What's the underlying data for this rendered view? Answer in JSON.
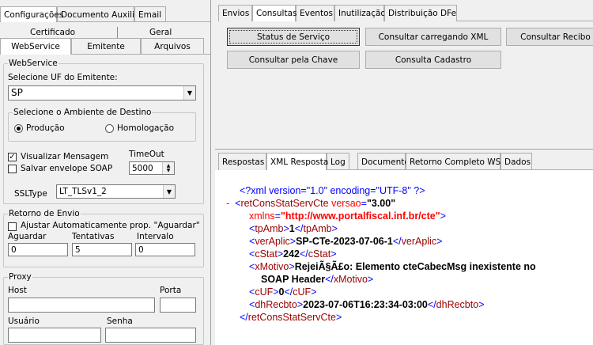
{
  "left_tabs": [
    "Configurações",
    "Documento Auxiliar",
    "Email"
  ],
  "config_tabs_row1": [
    "Certificado",
    "Geral"
  ],
  "config_tabs_row2": [
    "WebService",
    "Emitente",
    "Arquivos"
  ],
  "webservice": {
    "group": "WebService",
    "uf_label": "Selecione UF do Emitente:",
    "uf_value": "SP",
    "ambiente_group": "Selecione o Ambiente de Destino",
    "producao": "Produção",
    "homologacao": "Homologação",
    "visualizar": "Visualizar Mensagem",
    "salvar": "Salvar envelope SOAP",
    "timeout_label": "TimeOut",
    "timeout_value": "5000",
    "ssltype_label": "SSLType",
    "ssltype_value": "LT_TLSv1_2"
  },
  "retorno": {
    "group": "Retorno de Envio",
    "ajustar": "Ajustar Automaticamente prop. \"Aguardar\"",
    "aguardar_label": "Aguardar",
    "aguardar_value": "0",
    "tentativas_label": "Tentativas",
    "tentativas_value": "5",
    "intervalo_label": "Intervalo",
    "intervalo_value": "0"
  },
  "proxy": {
    "group": "Proxy",
    "host": "Host",
    "porta": "Porta",
    "usuario": "Usuário",
    "senha": "Senha"
  },
  "right_tabs": [
    "Envios",
    "Consultas",
    "Eventos",
    "Inutilização",
    "Distribuição DFe"
  ],
  "buttons": {
    "status": "Status de Serviço",
    "xml": "Consultar carregando XML",
    "recibo": "Consultar Recibo",
    "chave": "Consultar pela Chave",
    "cadastro": "Consulta Cadastro"
  },
  "resp_tabs": [
    "Respostas",
    "XML Resposta",
    "Log",
    "Documento",
    "Retorno Completo WS",
    "Dados"
  ],
  "xml": {
    "decl": "<?xml version=\"1.0\" encoding=\"UTF-8\" ?>",
    "minus": "-",
    "lt": "<",
    "gt": ">",
    "close_lt": "</",
    "root": "retConsStatServCte",
    "attr_versao": "versao",
    "eq": "=",
    "versao_value": "\"3.00\"",
    "attr_xmlns": "xmlns",
    "xmlns_value": "\"http://www.portalfiscal.inf.br/cte\"",
    "tpAmb_tag": "tpAmb",
    "tpAmb": "1",
    "verAplic_tag": "verAplic",
    "verAplic": "SP-CTe-2023-07-06-1",
    "cStat_tag": "cStat",
    "cStat": "242",
    "xMotivo_tag": "xMotivo",
    "xMotivo_1": "RejeiÃ§Ã£o: Elemento cteCabecMsg inexistente no",
    "xMotivo_2": "SOAP Header",
    "cUF_tag": "cUF",
    "cUF": "0",
    "dhRecbto_tag": "dhRecbto",
    "dhRecbto": "2023-07-06T16:23:34-03:00"
  }
}
